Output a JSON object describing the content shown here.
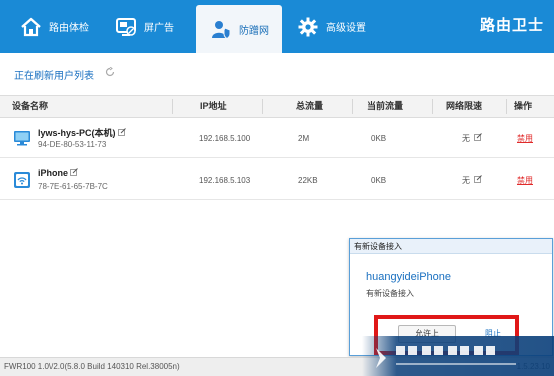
{
  "nav": {
    "tabs": [
      {
        "label": "路由体检",
        "icon": "home-icon"
      },
      {
        "label": "屏广告",
        "icon": "ad-block-icon"
      },
      {
        "label": "防蹭网",
        "icon": "user-shield-icon",
        "active": true
      },
      {
        "label": "高级设置",
        "icon": "gear-icon"
      }
    ],
    "brand": "路由卫士"
  },
  "status": {
    "message": "正在刷新用户列表",
    "icon": "refresh-icon"
  },
  "table": {
    "headers": [
      "设备名称",
      "IP地址",
      "总流量",
      "当前流量",
      "网络限速",
      "操作"
    ],
    "rows": [
      {
        "name": "lyws-hys-PC(本机)",
        "mac": "94-DE-80-53-11-73",
        "ip": "192.168.5.100",
        "total": "2M",
        "current": "0KB",
        "limit": "无",
        "action": "禁用",
        "icon": "computer-icon"
      },
      {
        "name": "iPhone",
        "mac": "78-7E-61-65-7B-7C",
        "ip": "192.168.5.103",
        "total": "22KB",
        "current": "0KB",
        "limit": "无",
        "action": "禁用",
        "icon": "wifi-device-icon"
      }
    ]
  },
  "popup": {
    "title": "有新设备接入",
    "device": "huangyideiPhone",
    "message": "有新设备接入",
    "allow_label": "允许上",
    "deny_label": "阻止"
  },
  "footer": {
    "version": "FWR100 1.0\\/2.0(5.8.0 Build 140310 Rel.38005n)",
    "version_right": "1.5.23.10"
  },
  "colors": {
    "accent": "#1a8ad6",
    "danger": "#e02a2a",
    "link": "#1a70c0"
  }
}
